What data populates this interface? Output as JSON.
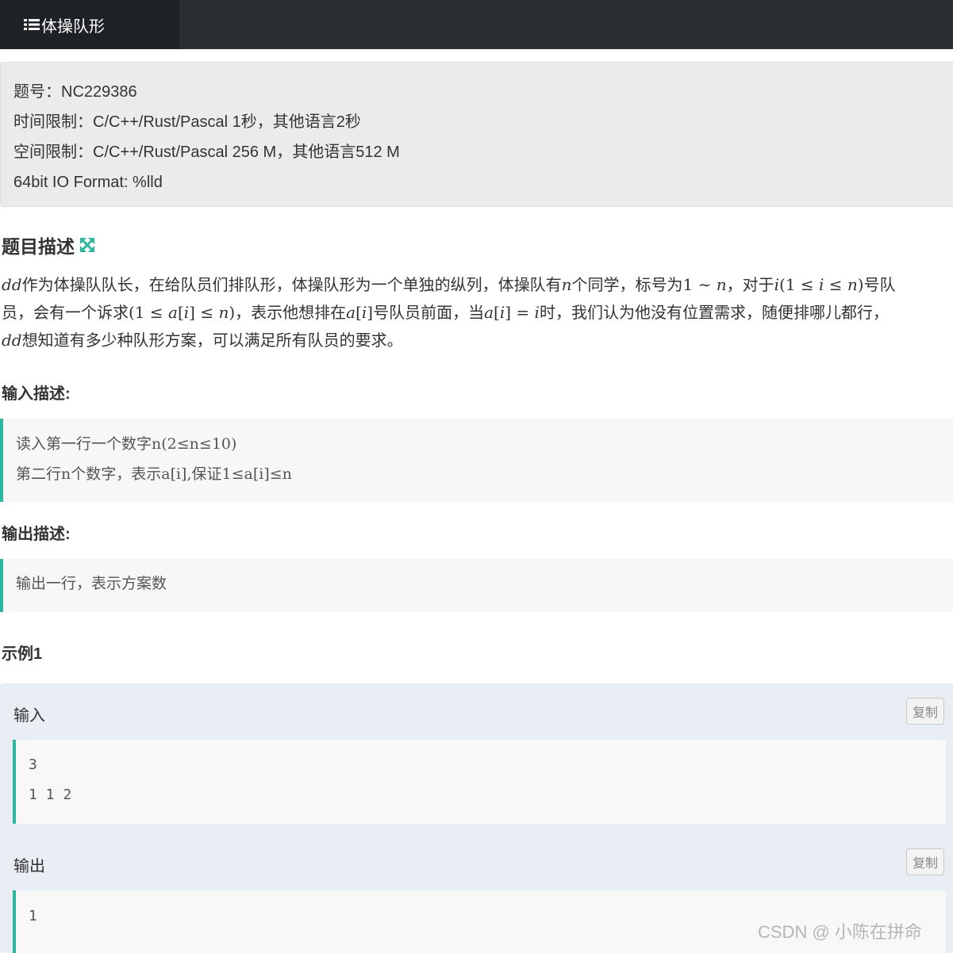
{
  "header": {
    "tab_title": "体操队形",
    "icon": "list-icon"
  },
  "info": {
    "problem_id": "题号：NC229386",
    "time_limit": "时间限制：C/C++/Rust/Pascal 1秒，其他语言2秒",
    "memory_limit": "空间限制：C/C++/Rust/Pascal 256 M，其他语言512 M",
    "io_format": "64bit IO Format: %lld"
  },
  "description": {
    "heading": "题目描述",
    "expand_icon": "expand-icon",
    "line1": {
      "m1": "dd",
      "t1": "作为体操队队长，在给队员们排队形，体操队形为一个单独的纵列，体操队有",
      "m2": "n",
      "t2": "个同学，标号为",
      "m3a": "1",
      "m3b": " ∼ ",
      "m3c": "n",
      "t3": "，对于",
      "m4a": "i",
      "m4b": "(1 ≤ ",
      "m4c": "i",
      "m4d": " ≤ ",
      "m4e": "n",
      "m4f": ")",
      "t4": "号队"
    },
    "line2": {
      "t1": "员，会有一个诉求",
      "m1a": "(1 ≤ ",
      "m1b": "a",
      "m1c": "[",
      "m1d": "i",
      "m1e": "] ≤ ",
      "m1f": "n",
      "m1g": ")",
      "t2": "，表示他想排在",
      "m2a": "a",
      "m2b": "[",
      "m2c": "i",
      "m2d": "]",
      "t3": "号队员前面，当",
      "m3a": "a",
      "m3b": "[",
      "m3c": "i",
      "m3d": "] = ",
      "m3e": "i",
      "t4": "时，我们认为他没有位置需求，随便排哪儿都行，"
    },
    "line3": {
      "m1": "dd",
      "t1": "想知道有多少种队形方案，可以满足所有队员的要求。"
    }
  },
  "input_desc": {
    "heading": "输入描述:",
    "line1": "读入第一行一个数字n(2≤n≤10)",
    "line2": "第二行n个数字，表示a[i],保证1≤a[i]≤n"
  },
  "output_desc": {
    "heading": "输出描述:",
    "line1": "输出一行，表示方案数"
  },
  "example": {
    "heading": "示例1",
    "input_label": "输入",
    "output_label": "输出",
    "copy_label": "复制",
    "input_lines": [
      "3",
      "1 1 2"
    ],
    "output_lines": [
      "1"
    ]
  },
  "watermark": "CSDN @ 小陈在拼命",
  "colors": {
    "accent": "#2db7a0",
    "topbar": "#2a2f33"
  }
}
